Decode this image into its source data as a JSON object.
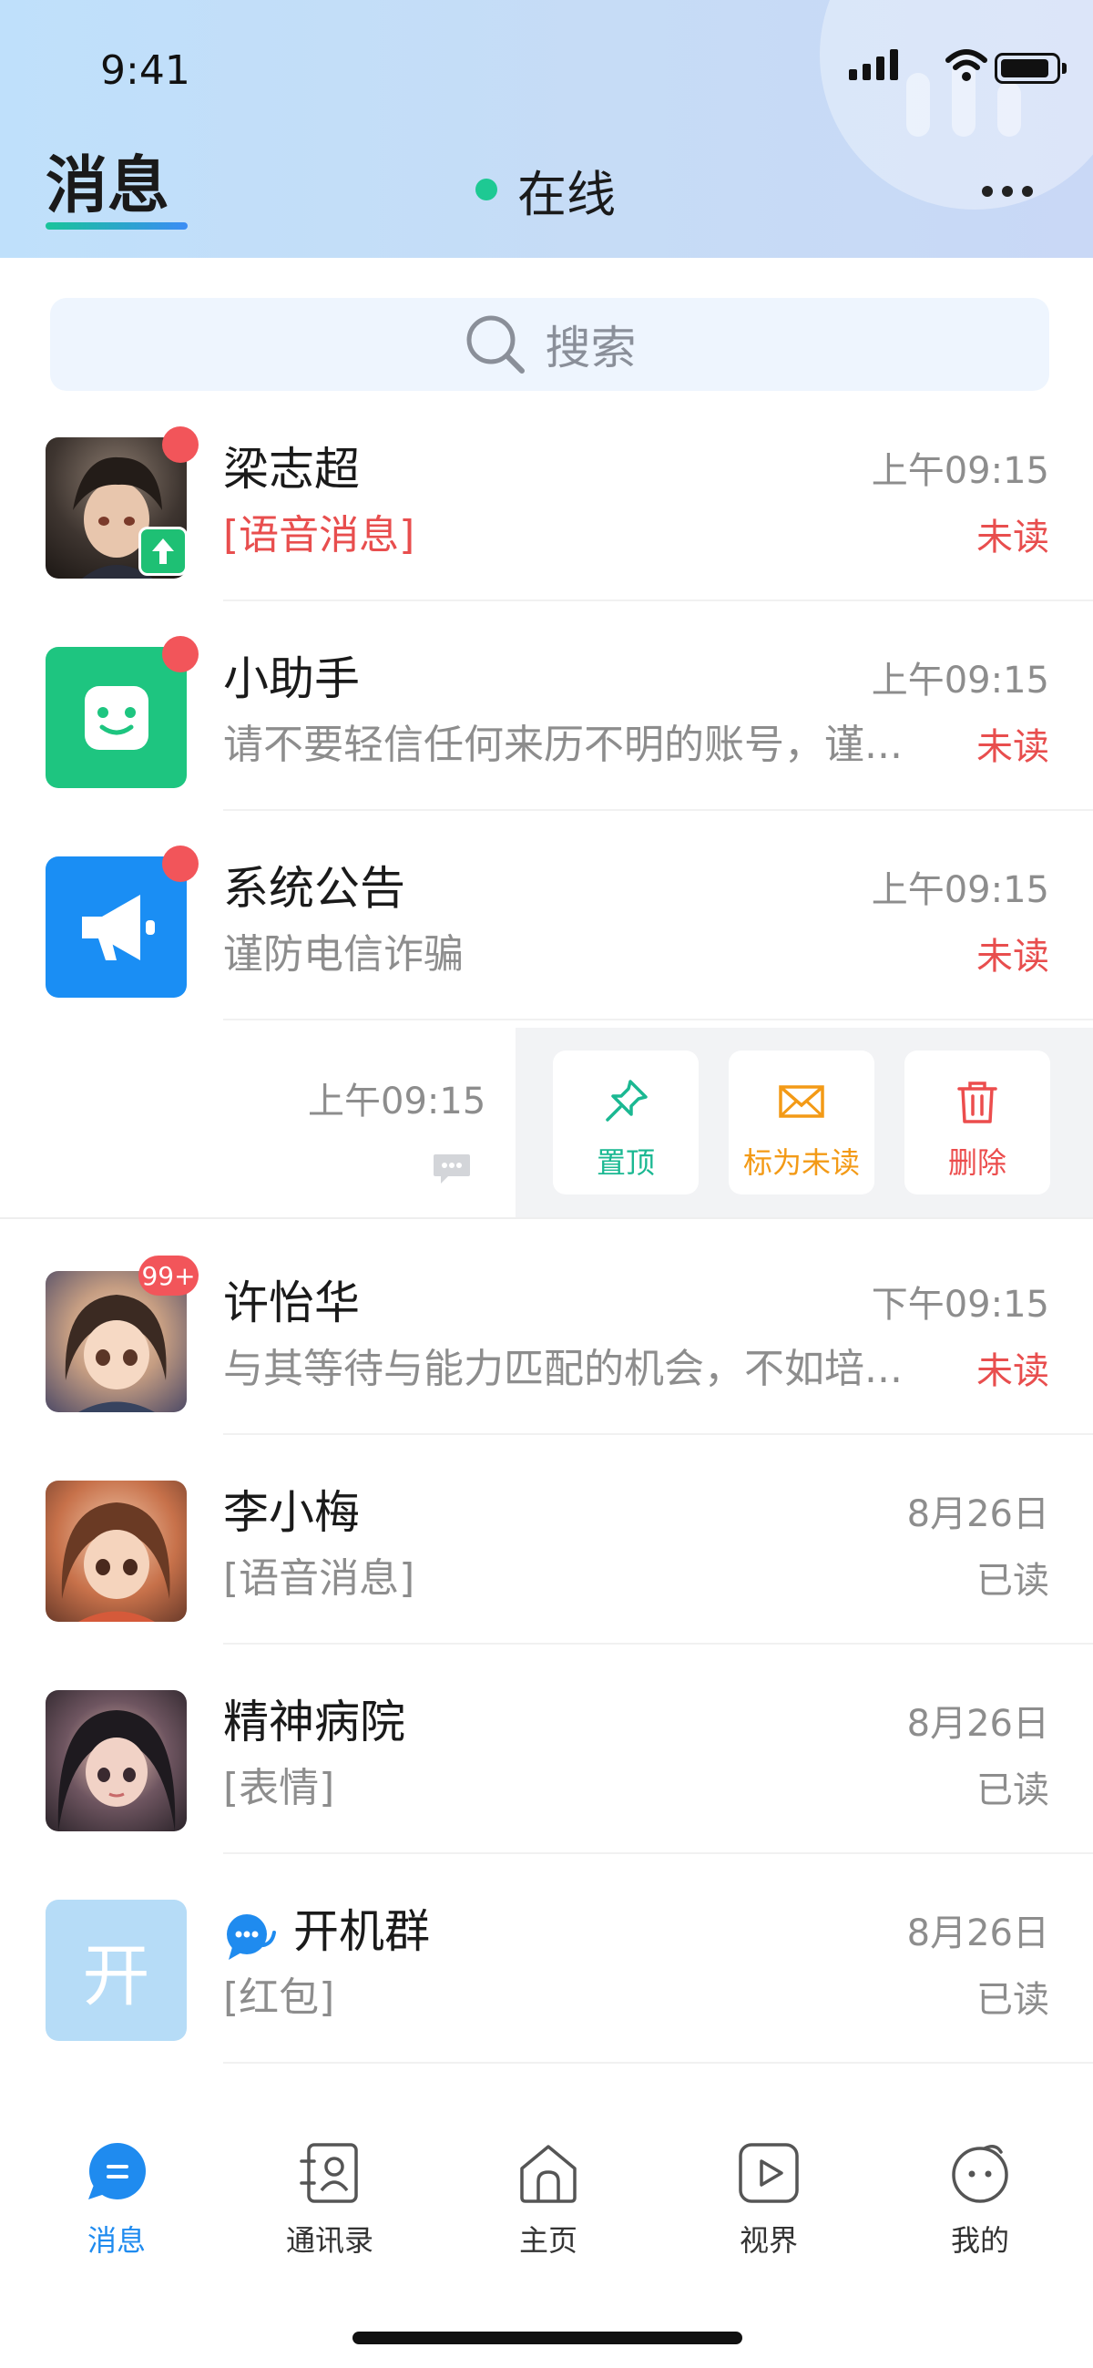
{
  "status_bar": {
    "time": "9:41"
  },
  "header": {
    "title": "消息",
    "online_label": "在线"
  },
  "search": {
    "placeholder": "搜索"
  },
  "conversations": [
    {
      "name": "梁志超",
      "preview": "[语音消息]",
      "time": "上午09:15",
      "status": "未读"
    },
    {
      "name": "小助手",
      "preview": "请不要轻信任何来历不明的账号，谨...",
      "time": "上午09:15",
      "status": "未读"
    },
    {
      "name": "系统公告",
      "preview": "谨防电信诈骗",
      "time": "上午09:15",
      "status": "未读"
    },
    {
      "name": "许怡华",
      "preview": "与其等待与能力匹配的机会，不如培...",
      "time": "下午09:15",
      "status": "未读",
      "badge": "99+"
    },
    {
      "name": "李小梅",
      "preview": "[语音消息]",
      "time": "8月26日",
      "status": "已读"
    },
    {
      "name": "精神病院",
      "preview": "[表情]",
      "time": "8月26日",
      "status": "已读"
    },
    {
      "name": "开机群",
      "preview": "[红包]",
      "time": "8月26日",
      "status": "已读",
      "avatar_text": "开"
    }
  ],
  "swiped_row": {
    "time": "上午09:15",
    "actions": [
      {
        "label": "置顶",
        "icon": "pin-icon",
        "color": "#1bb892"
      },
      {
        "label": "标为未读",
        "icon": "envelope-icon",
        "color": "#f39a16"
      },
      {
        "label": "删除",
        "icon": "trash-icon",
        "color": "#ec4d4d"
      }
    ]
  },
  "tabbar": {
    "tabs": [
      {
        "label": "消息",
        "icon": "chat-icon",
        "active": true
      },
      {
        "label": "通讯录",
        "icon": "contacts-icon",
        "active": false
      },
      {
        "label": "主页",
        "icon": "home-icon",
        "active": false
      },
      {
        "label": "视界",
        "icon": "play-icon",
        "active": false
      },
      {
        "label": "我的",
        "icon": "profile-icon",
        "active": false
      }
    ]
  },
  "colors": {
    "accent": "#1f8bef",
    "online": "#1ec993",
    "unread": "#e84e4e",
    "assistant": "#1ec580",
    "announcement": "#1a8ef4"
  }
}
